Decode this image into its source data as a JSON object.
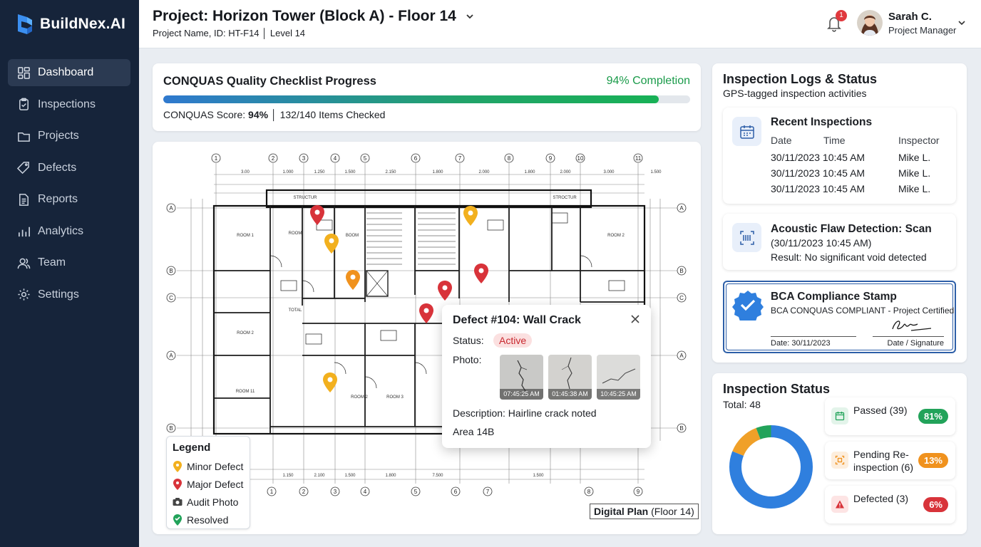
{
  "app": {
    "brand": "BuildNex.AI"
  },
  "sidebar": {
    "items": [
      {
        "label": "Dashboard",
        "icon": "dashboard-icon",
        "active": true
      },
      {
        "label": "Inspections",
        "icon": "clipboard-icon"
      },
      {
        "label": "Projects",
        "icon": "folder-icon"
      },
      {
        "label": "Defects",
        "icon": "tag-icon"
      },
      {
        "label": "Reports",
        "icon": "document-icon"
      },
      {
        "label": "Analytics",
        "icon": "bar-chart-icon"
      },
      {
        "label": "Team",
        "icon": "users-icon"
      },
      {
        "label": "Settings",
        "icon": "gear-icon"
      }
    ]
  },
  "header": {
    "title": "Project: Horizon Tower (Block A) - Floor 14",
    "subtitle": "Project Name, ID: HT-F14  │  Level 14",
    "notifications": "1",
    "user": {
      "name": "Sarah C.",
      "role": "Project Manager"
    }
  },
  "progress": {
    "title": "CONQUAS Quality Checklist Progress",
    "completion_label": "94% Completion",
    "completion": 0.94,
    "score_prefix": "CONQUAS Score: ",
    "score": "94%",
    "score_suffix": " │ 132/140 Items Checked"
  },
  "plan": {
    "label_bold": "Digital Plan",
    "label_rest": " (Floor 14)",
    "legend": {
      "title": "Legend",
      "items": [
        {
          "label": "Minor Defect",
          "color": "#f2b01e"
        },
        {
          "label": "Major Defect",
          "color": "#d8333a"
        },
        {
          "label": "Audit Photo",
          "color": "#444444"
        },
        {
          "label": "Resolved",
          "color": "#22a35a"
        }
      ]
    },
    "grid_top": [
      "1",
      "2",
      "3",
      "4",
      "5",
      "6",
      "7",
      "8",
      "9",
      "10",
      "11"
    ],
    "grid_bottom": [
      "1",
      "2",
      "3",
      "4",
      "5",
      "6",
      "7",
      "8",
      "9",
      "10"
    ],
    "grid_side": [
      "A",
      "B",
      "C",
      "A",
      "B"
    ],
    "rooms": [
      "ROOM 1",
      "ROOM 2",
      "ROOM 2",
      "ROOM 11",
      "ROOM 3",
      "ROOM",
      "BOOM",
      "ROOM 2",
      "TOTAL",
      "STRUCTUR",
      "STROCTUR"
    ],
    "dims": [
      "3.00",
      "1.000",
      "1.250",
      "1.500",
      "2.150",
      "1.800",
      "2.000",
      "1.800",
      "2.000",
      "3.000",
      "1.500",
      "1.150",
      "2.100",
      "1.500",
      "1.800",
      "7.500",
      "1.500"
    ]
  },
  "popup": {
    "title": "Defect #104: Wall Crack",
    "status_label": "Status:",
    "status": "Active",
    "photo_label": "Photo:",
    "photos": [
      {
        "time": "07:45:25 AM"
      },
      {
        "time": "01:45:38 AM"
      },
      {
        "time": "10:45:25 AM"
      }
    ],
    "description": "Description: Hairline crack noted",
    "area": "Area 14B"
  },
  "logs": {
    "title": "Inspection Logs & Status",
    "subtitle": "GPS-tagged inspection activities",
    "recent": {
      "title": "Recent Inspections",
      "headers": [
        "Date",
        "Time",
        "Inspector"
      ],
      "rows": [
        {
          "datetime": "30/11/2023 10:45 AM",
          "inspector": "Mike L."
        },
        {
          "datetime": "30/11/2023 10:45 AM",
          "inspector": "Mike L."
        },
        {
          "datetime": "30/11/2023 10:45 AM",
          "inspector": "Mike L."
        }
      ]
    },
    "acoustic": {
      "title": "Acoustic Flaw Detection: Scan",
      "time": "(30/11/2023 10:45 AM)",
      "result": "Result: No significant void detected"
    },
    "bca": {
      "title": "BCA Compliance Stamp",
      "subtitle": "BCA CONQUAS COMPLIANT - Project Certified",
      "date": "Date: 30/11/2023",
      "signature_label": "Date / Signature"
    }
  },
  "status": {
    "title": "Inspection Status",
    "total": "Total: 48",
    "items": [
      {
        "label": "Passed (39)",
        "pct": "81%",
        "value": 0.81,
        "color": "#22a35a",
        "icon": "calendar-check-icon"
      },
      {
        "label": "Pending Re-inspection (6)",
        "pct": "13%",
        "value": 0.13,
        "color": "#f0921e",
        "icon": "scan-icon"
      },
      {
        "label": "Defected (3)",
        "pct": "6%",
        "value": 0.06,
        "color": "#d8333a",
        "icon": "warning-icon"
      }
    ],
    "donut_colors": [
      "#2f7fde",
      "#f0a028",
      "#22a35a"
    ]
  }
}
